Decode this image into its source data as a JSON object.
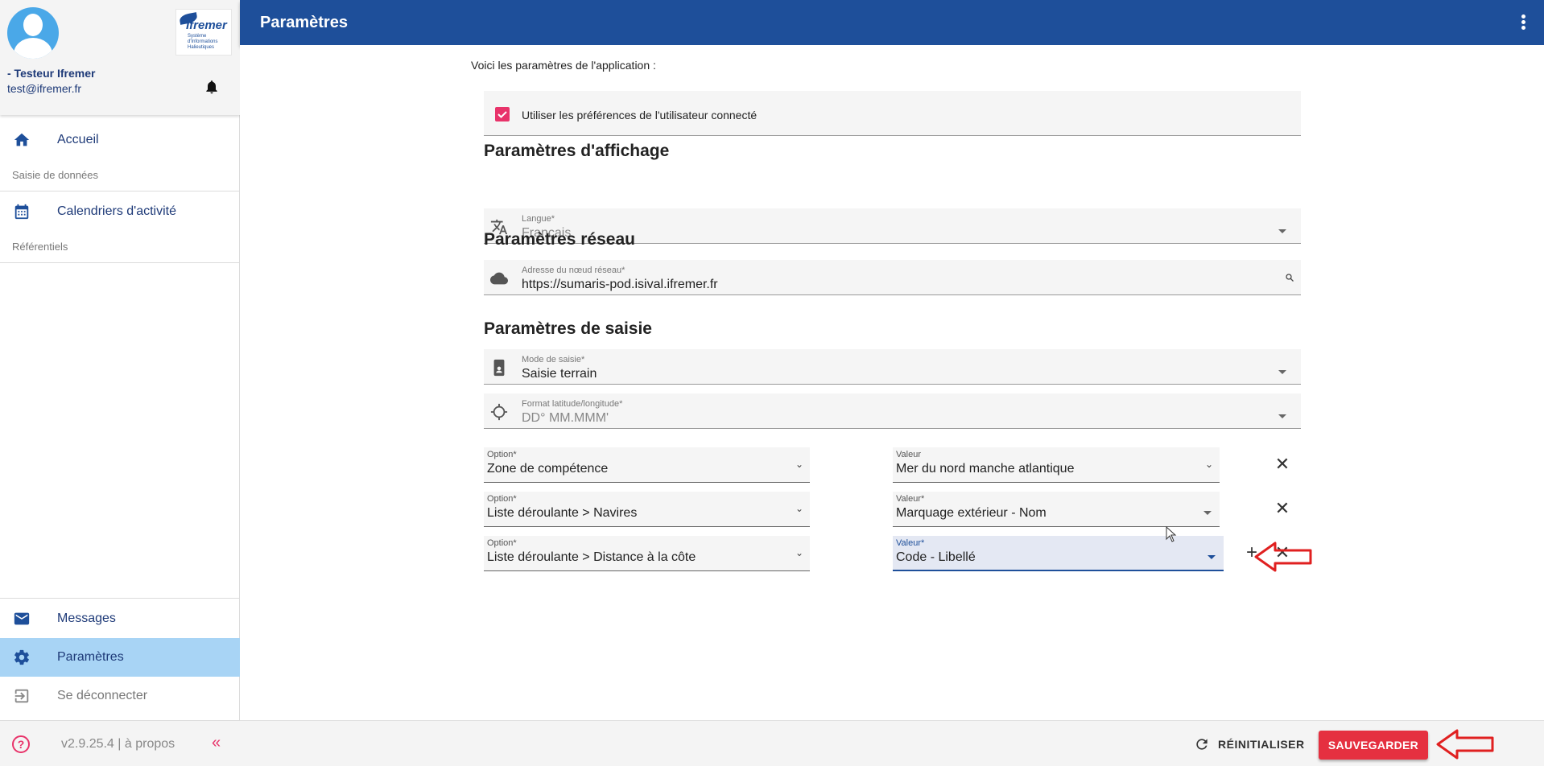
{
  "app": {
    "page_title": "Paramètres"
  },
  "user": {
    "name": "- Testeur Ifremer",
    "email": "test@ifremer.fr"
  },
  "logo": {
    "name": "Ifremer",
    "subtitle": "Système d'Informations Halieutiques"
  },
  "sidebar": {
    "items": [
      {
        "label": "Accueil",
        "icon": "home-icon"
      },
      {
        "section": "Saisie de données"
      },
      {
        "label": "Calendriers d'activité",
        "icon": "calendar-icon"
      },
      {
        "section": "Référentiels"
      }
    ],
    "bottom_items": [
      {
        "label": "Messages",
        "icon": "envelope-icon"
      },
      {
        "label": "Paramètres",
        "icon": "gear-icon",
        "active": true
      },
      {
        "label": "Se déconnecter",
        "icon": "logout-icon"
      }
    ],
    "version": "v2.9.25.4 | à propos",
    "collapse_label": "«"
  },
  "content": {
    "intro": "Voici les paramètres de l'application :",
    "use_user_prefs": {
      "label": "Utiliser les préférences de l'utilisateur connecté",
      "checked": true
    },
    "display_section": {
      "title": "Paramètres d'affichage",
      "language": {
        "label": "Langue*",
        "value": "Français",
        "icon": "translate-icon"
      }
    },
    "network_section": {
      "title": "Paramètres réseau",
      "node": {
        "label": "Adresse du nœud réseau*",
        "value": "https://sumaris-pod.isival.ifremer.fr",
        "icon": "cloud-icon"
      }
    },
    "input_section": {
      "title": "Paramètres de saisie",
      "mode": {
        "label": "Mode de saisie*",
        "value": "Saisie terrain",
        "icon": "mobile-icon"
      },
      "latlon": {
        "label": "Format latitude/longitude*",
        "value": "DD° MM.MMM'",
        "icon": "crosshair-icon"
      },
      "options": [
        {
          "option_label": "Option*",
          "option_value": "Zone de compétence",
          "value_label": "Valeur",
          "value_value": "Mer du nord manche atlantique"
        },
        {
          "option_label": "Option*",
          "option_value": "Liste déroulante > Navires",
          "value_label": "Valeur*",
          "value_value": "Marquage extérieur - Nom"
        },
        {
          "option_label": "Option*",
          "option_value": "Liste déroulante > Distance à la côte",
          "value_label": "Valeur*",
          "value_value": "Code - Libellé"
        }
      ]
    }
  },
  "footer": {
    "reset_label": "RÉINITIALISER",
    "save_label": "SAUVEGARDER"
  },
  "colors": {
    "primary": "#1e4f9a",
    "accent": "#e8336a",
    "save": "#e53040",
    "active_nav": "#a8d4f5"
  }
}
